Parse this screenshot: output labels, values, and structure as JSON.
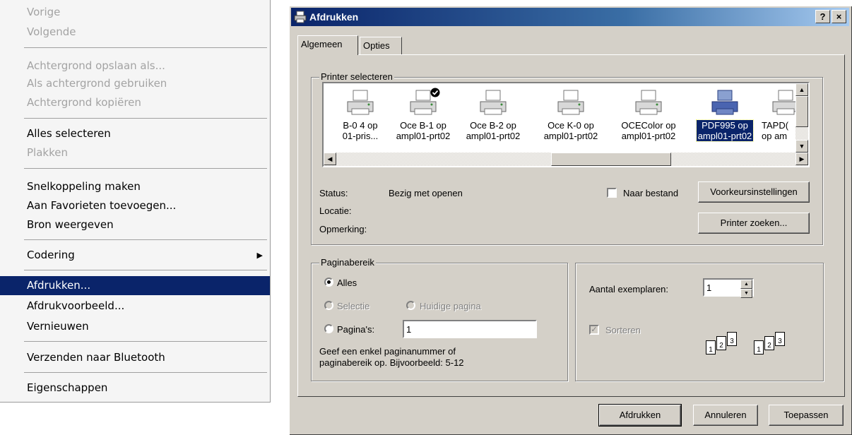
{
  "context_menu": {
    "items": [
      {
        "label": "Vorige",
        "disabled": true
      },
      {
        "label": "Volgende",
        "disabled": true
      },
      {
        "label": "Achtergrond opslaan als...",
        "disabled": true
      },
      {
        "label": "Als achtergrond gebruiken",
        "disabled": true
      },
      {
        "label": "Achtergrond kopiëren",
        "disabled": true
      },
      {
        "label": "Alles selecteren",
        "disabled": false
      },
      {
        "label": "Plakken",
        "disabled": true
      },
      {
        "label": "Snelkoppeling maken",
        "disabled": false
      },
      {
        "label": "Aan Favorieten toevoegen...",
        "disabled": false
      },
      {
        "label": "Bron weergeven",
        "disabled": false
      },
      {
        "label": "Codering",
        "disabled": false
      },
      {
        "label": "Afdrukken...",
        "disabled": false,
        "selected": true
      },
      {
        "label": "Afdrukvoorbeeld...",
        "disabled": false
      },
      {
        "label": "Vernieuwen",
        "disabled": false
      },
      {
        "label": "Verzenden naar Bluetooth",
        "disabled": false
      },
      {
        "label": "Eigenschappen",
        "disabled": false
      }
    ]
  },
  "dialog": {
    "title": "Afdrukken",
    "help_btn": "?",
    "close_btn": "×",
    "tabs": [
      "Algemeen",
      "Opties"
    ],
    "printer_group_label": "Printer selecteren",
    "printers": [
      {
        "line1": "B-0 4 op",
        "line2": "01-pris...",
        "selected": false,
        "default": false
      },
      {
        "line1": "Oce B-1 op",
        "line2": "ampl01-prt02",
        "selected": false,
        "default": true
      },
      {
        "line1": "Oce B-2 op",
        "line2": "ampl01-prt02",
        "selected": false,
        "default": false
      },
      {
        "line1": "Oce K-0 op",
        "line2": "ampl01-prt02",
        "selected": false,
        "default": false
      },
      {
        "line1": "OCEColor op",
        "line2": "ampl01-prt02",
        "selected": false,
        "default": false
      },
      {
        "line1": "PDF995 op",
        "line2": "ampl01-prt02",
        "selected": true,
        "default": false
      },
      {
        "line1": "TAPD(",
        "line2": "op am",
        "selected": false,
        "default": false
      }
    ],
    "status_label": "Status:",
    "status_value": "Bezig met openen",
    "location_label": "Locatie:",
    "comment_label": "Opmerking:",
    "print_to_file_label": "Naar bestand",
    "preferences_btn": "Voorkeursinstellingen",
    "find_printer_btn": "Printer zoeken...",
    "page_range": {
      "group_label": "Paginabereik",
      "all_label": "Alles",
      "selection_label": "Selectie",
      "current_page_label": "Huidige pagina",
      "pages_label": "Pagina's:",
      "pages_value": "1",
      "hint_line1": "Geef een enkel paginanummer of",
      "hint_line2": "paginabereik op. Bijvoorbeeld: 5-12"
    },
    "copies": {
      "label": "Aantal exemplaren:",
      "value": "1",
      "collate_label": "Sorteren",
      "page_numbers": [
        "1",
        "2",
        "3"
      ]
    },
    "buttons": {
      "print": "Afdrukken",
      "cancel": "Annuleren",
      "apply": "Toepassen"
    }
  }
}
